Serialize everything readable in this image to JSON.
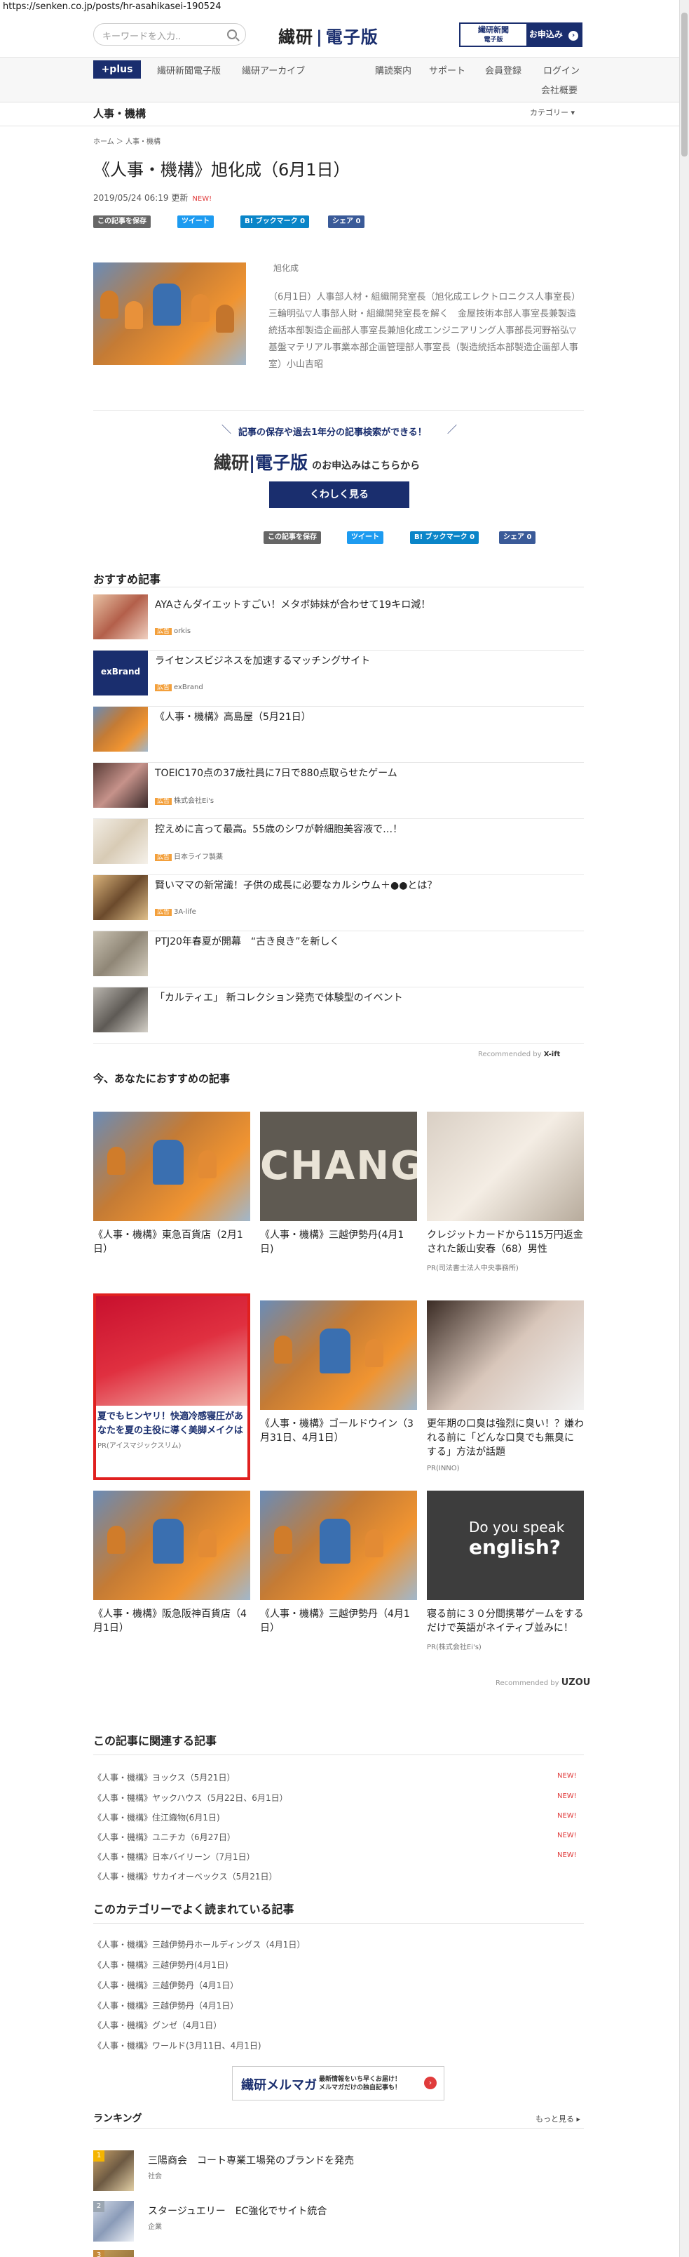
{
  "url": "https://senken.co.jp/posts/hr-asahikasei-190524",
  "header": {
    "search_placeholder": "キーワードを入力..",
    "logo_left": "繊研",
    "logo_sep": "|",
    "logo_right": "電子版",
    "newspaper_line1": "繊研新聞",
    "newspaper_line2": "電子版",
    "subscribe_label": "お申込み"
  },
  "nav": {
    "plus": "+plus",
    "links": [
      "繊研新聞電子版",
      "繊研アーカイブ",
      "購読案内",
      "サポート",
      "会員登録",
      "ログイン"
    ],
    "company": "会社概要"
  },
  "category": {
    "title": "人事・機構",
    "dropdown": "カテゴリー ▾"
  },
  "breadcrumb": "ホーム ＞ 人事・機構",
  "article": {
    "title": "《人事・機構》旭化成（6月1日）",
    "date": "2019/05/24 06:19 更新",
    "new": "NEW!",
    "share": {
      "save": "この記事を保存",
      "tweet": "ツイート",
      "bookmark": "B! ブックマーク 0",
      "facebook": "シェア 0"
    },
    "company": "旭化成",
    "summary": "（6月1日）人事部人材・組織開発室長（旭化成エレクトロニクス人事室長）三輪明弘▽人事部人財・組織開発室長を解く　金屋技術本部人事室長兼製造統括本部製造企画部人事室長兼旭化成エンジニアリング人事部長河野裕弘▽基盤マテリアル事業本部企画管理部人事室長（製造統括本部製造企画部人事室）小山吉昭"
  },
  "cta": {
    "text": "記事の保存や過去1年分の記事検索ができる！",
    "logo_left": "繊研",
    "logo_sep": "|",
    "logo_right": "電子版",
    "logo_small": "のお申込みはこちらから",
    "button": "くわしく見る"
  },
  "recommend": {
    "heading": "おすすめ記事",
    "items": [
      {
        "title": "AYAさんダイエットすごい！メタボ姉妹が合わせて19キロ減！",
        "pr": "orkis"
      },
      {
        "title": "ライセンスビジネスを加速するマッチングサイト",
        "pr": "exBrand",
        "logo": "exBrand"
      },
      {
        "title": "《人事・機構》高島屋（5月21日）",
        "pr": ""
      },
      {
        "title": "TOEIC170点の37歳社員に7日で880点取らせたゲーム",
        "pr": "株式会社Ei's"
      },
      {
        "title": "控えめに言って最高。55歳のシワが幹細胞美容液で…！",
        "pr": "日本ライフ製薬"
      },
      {
        "title": "賢いママの新常識！子供の成長に必要なカルシウム＋●●とは？",
        "pr": "3A-life"
      },
      {
        "title": "PTJ20年春夏が開幕　“古き良き”を新しく",
        "pr": ""
      },
      {
        "title": "「カルティエ」 新コレクション発売で体験型のイベント",
        "pr": ""
      }
    ],
    "pr_tag": "広告",
    "footer": "Recommended by",
    "brand": "X-ift"
  },
  "now_recommend": {
    "heading": "今、あなたにおすすめの記事",
    "cards": [
      {
        "title": "《人事・機構》東急百貨店（2月1日）",
        "pr": ""
      },
      {
        "title": "《人事・機構》三越伊勢丹(4月1日)",
        "pr": "",
        "img_text": "CHANG"
      },
      {
        "title": "クレジットカードから115万円返金された飯山安春（68）男性",
        "pr": "PR(司法書士法人中央事務所)"
      },
      {
        "title": "夏でもヒンヤリ！快適冷感寝圧があなたを夏の主役に導く美脚メイクは",
        "pr": "PR(アイスマジックスリム)"
      },
      {
        "title": "《人事・機構》ゴールドウイン（3月31日、4月1日）",
        "pr": ""
      },
      {
        "title": "更年期の口臭は強烈に臭い！？嫌われる前に「どんな口臭でも無臭にする」方法が話題",
        "pr": "PR(INNO)"
      },
      {
        "title": "《人事・機構》阪急阪神百貨店（4月1日）",
        "pr": ""
      },
      {
        "title": "《人事・機構》三越伊勢丹（4月1日）",
        "pr": ""
      },
      {
        "title": "寝る前に３０分間携帯ゲームをするだけで英語がネイティブ並みに！",
        "pr": "PR(株式会社Ei's)",
        "img_text1": "Do you speak",
        "img_text2": "english?"
      }
    ],
    "footer": "Recommended by",
    "brand": "UZOU"
  },
  "related": {
    "heading": "この記事に関連する記事",
    "items": [
      {
        "title": "《人事・機構》ヨックス（5月21日）",
        "new": "NEW!"
      },
      {
        "title": "《人事・機構》ヤックハウス（5月22日、6月1日）",
        "new": "NEW!"
      },
      {
        "title": "《人事・機構》住江織物(6月1日)",
        "new": "NEW!"
      },
      {
        "title": "《人事・機構》ユニチカ（6月27日）",
        "new": "NEW!"
      },
      {
        "title": "《人事・機構》日本バイリーン（7月1日）",
        "new": "NEW!"
      },
      {
        "title": "《人事・機構》サカイオーベックス（5月21日）",
        "new": ""
      }
    ]
  },
  "popular": {
    "heading": "このカテゴリーでよく読まれている記事",
    "items": [
      "《人事・機構》三越伊勢丹ホールディングス（4月1日）",
      "《人事・機構》三越伊勢丹(4月1日)",
      "《人事・機構》三越伊勢丹（4月1日）",
      "《人事・機構》三越伊勢丹（4月1日）",
      "《人事・機構》グンゼ（4月1日）",
      "《人事・機構》ワールド(3月11日、4月1日)"
    ]
  },
  "magazine": {
    "title": "繊研メルマガ",
    "line1": "最新情報をいち早くお届け！",
    "line2": "メルマガだけの独自記事も！",
    "close": "›"
  },
  "ranking": {
    "heading": "ランキング",
    "more": "もっと見る ▸",
    "items": [
      {
        "num": "1",
        "title": "三陽商会　コート専業工場発のブランドを発売",
        "cat": "社会"
      },
      {
        "num": "2",
        "title": "スタージュエリー　EC強化でサイト統合",
        "cat": "企業"
      },
      {
        "num": "3",
        "title": "",
        "cat": ""
      }
    ]
  }
}
